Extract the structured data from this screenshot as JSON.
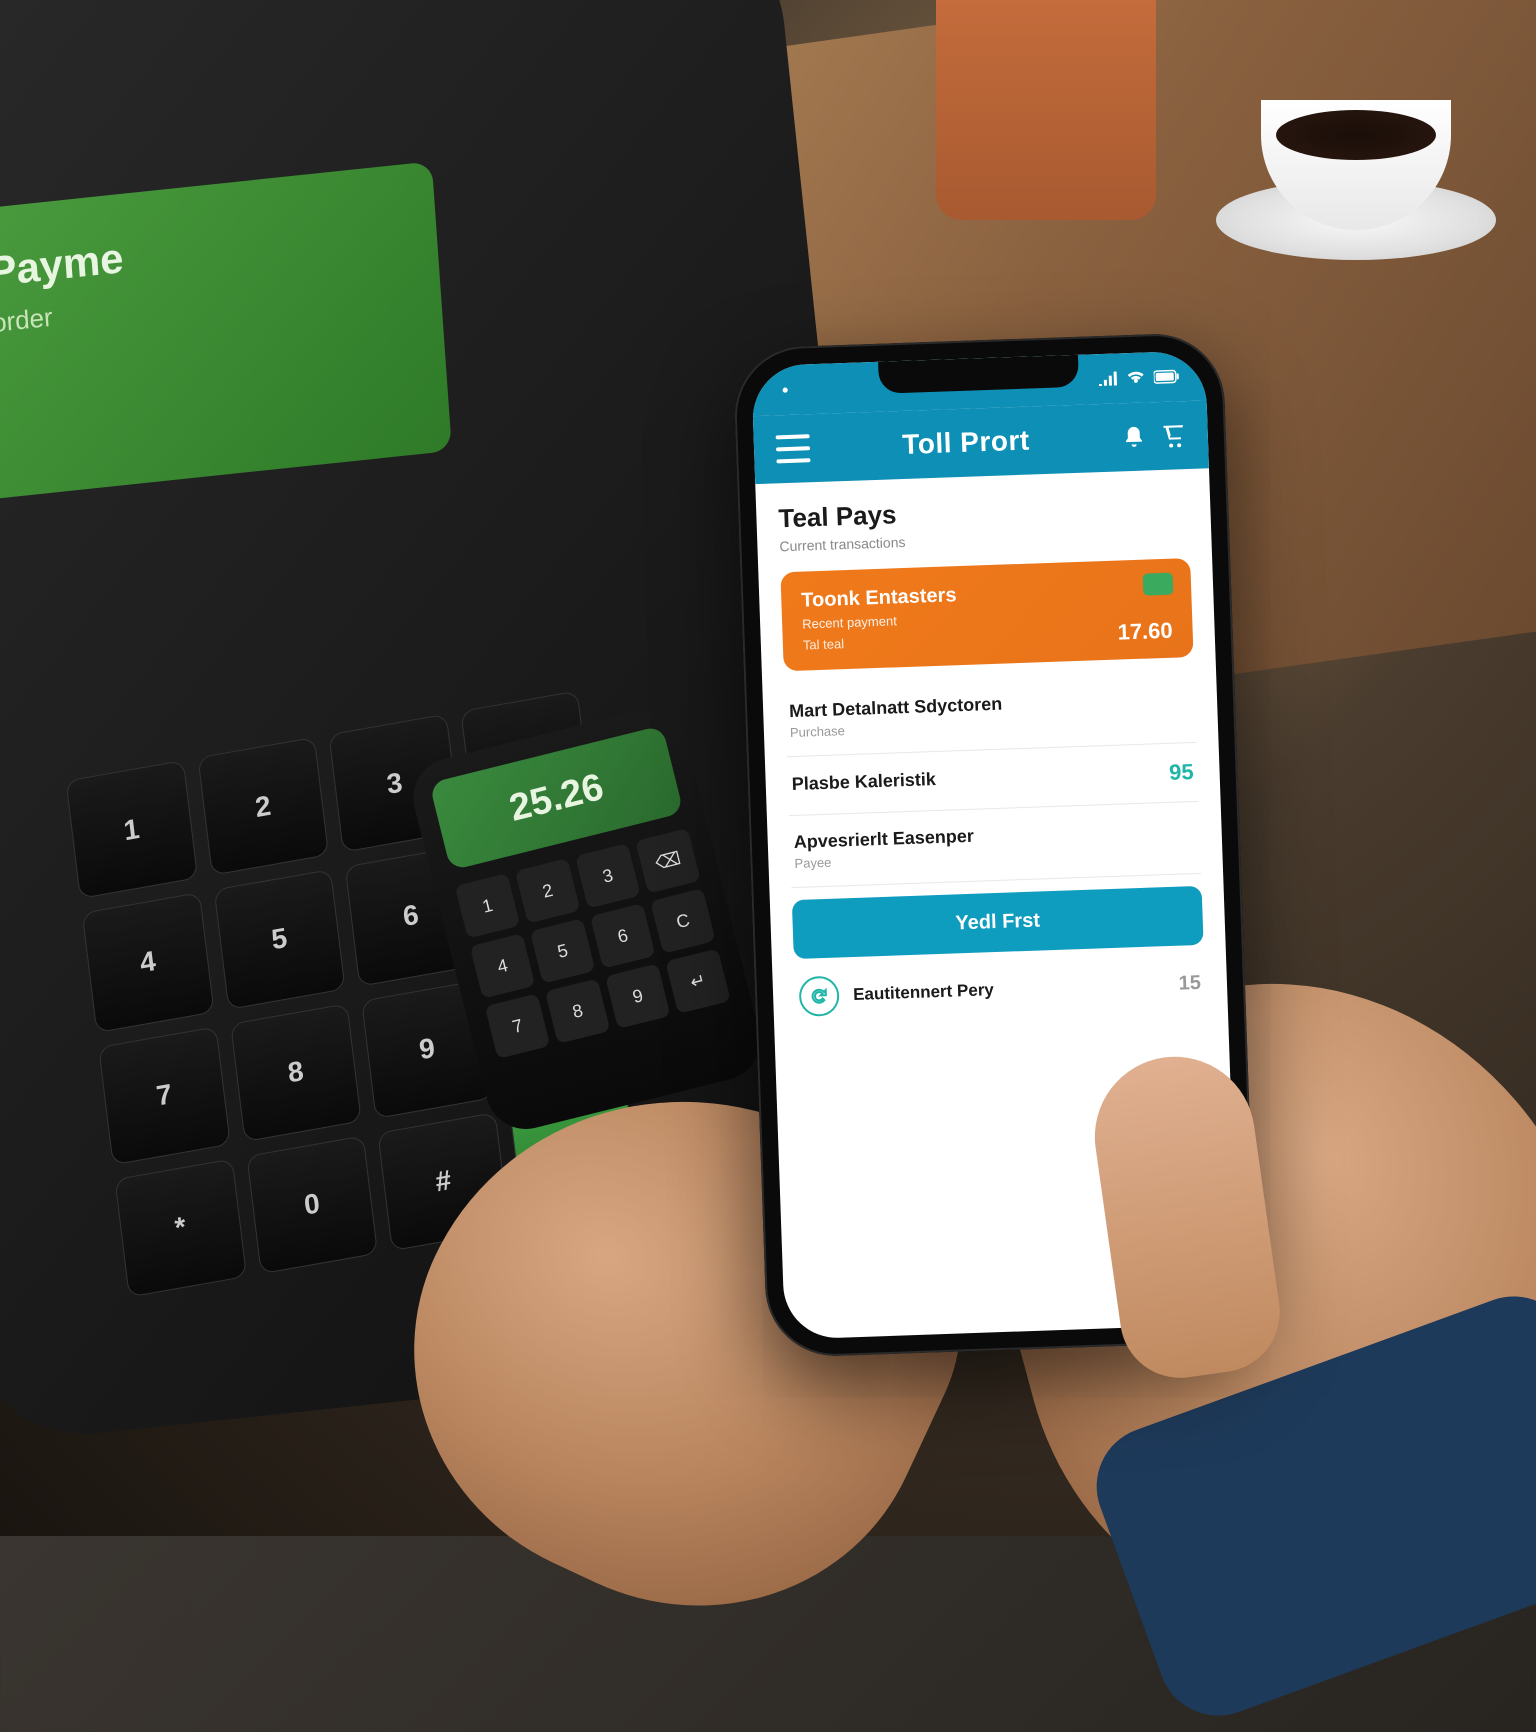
{
  "terminal": {
    "screen_line1": "Payme",
    "screen_line2": "order",
    "pinpad_value": "25.26"
  },
  "phone": {
    "status": {
      "left_indicator": "•",
      "signal_icon": "signal",
      "wifi_icon": "wifi",
      "battery_icon": "battery"
    },
    "header": {
      "menu_icon": "menu",
      "title": "Toll Prort",
      "bell_icon": "bell",
      "cart_icon": "cart"
    },
    "section": {
      "title": "Teal Pays",
      "subtitle": "Current transactions"
    },
    "orange_card": {
      "title": "Toonk Entasters",
      "subtitle": "Recent payment",
      "tag": "Tal teal",
      "amount": "17.60"
    },
    "items": [
      {
        "title": "Mart Detalnatt Sdyctoren",
        "subtitle": "Purchase",
        "value": ""
      },
      {
        "title": "Plasbe Kaleristik",
        "subtitle": "",
        "value": "95"
      },
      {
        "title": "Apvesrierlt Easenper",
        "subtitle": "Payee",
        "value": ""
      }
    ],
    "button": {
      "label": "Yedl Frst"
    },
    "footer": {
      "icon": "refresh",
      "label": "Eautitennert Pery",
      "value": "15"
    },
    "colors": {
      "primary": "#0e8fb5",
      "accent": "#e8731a",
      "teal": "#1fb5a8"
    }
  }
}
